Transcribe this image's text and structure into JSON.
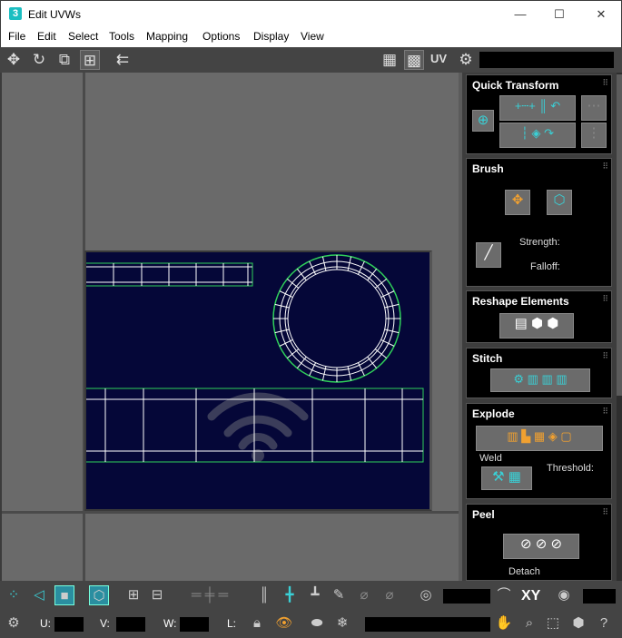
{
  "window": {
    "app_icon": "3",
    "title": "Edit UVWs",
    "minimize": "—",
    "maximize": "☐",
    "close": "✕"
  },
  "menu": [
    "File",
    "Edit",
    "Select",
    "Tools",
    "Mapping",
    "Options",
    "Display",
    "View"
  ],
  "toolbar": {
    "uv_label": "UV",
    "icons": [
      "move-icon",
      "rotate-icon",
      "scale-icon",
      "freeform-icon",
      "mirror-icon",
      "checker-icon",
      "checker-map-icon",
      "settings-icon"
    ]
  },
  "rollouts": {
    "quick_transform": {
      "title": "Quick Transform"
    },
    "brush": {
      "title": "Brush",
      "strength_label": "Strength:",
      "falloff_label": "Falloff:"
    },
    "reshape": {
      "title": "Reshape Elements"
    },
    "stitch": {
      "title": "Stitch"
    },
    "explode": {
      "title": "Explode",
      "weld_label": "Weld",
      "threshold_label": "Threshold:"
    },
    "peel": {
      "title": "Peel",
      "detach_label": "Detach"
    }
  },
  "bottom": {
    "xy_label": "XY",
    "u_label": "U:",
    "v_label": "V:",
    "w_label": "W:",
    "l_label": "L:",
    "u_value": "",
    "v_value": "",
    "w_value": ""
  },
  "colors": {
    "accent": "#3ad0d6",
    "uv_background": "#050738",
    "mesh_edge": "#ffffff",
    "mesh_border": "#2fd05a"
  }
}
